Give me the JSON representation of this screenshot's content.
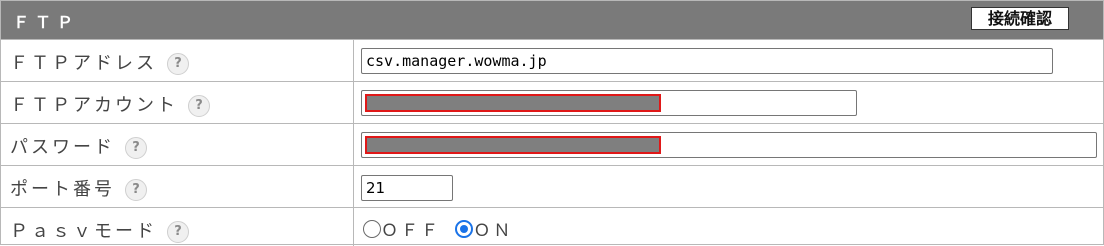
{
  "header": {
    "title": "ＦＴＰ",
    "test_button_label": "接続確認"
  },
  "rows": {
    "address": {
      "label": "ＦＴＰアドレス",
      "value": "csv.manager.wowma.jp"
    },
    "account": {
      "label": "ＦＴＰアカウント",
      "value": ""
    },
    "password": {
      "label": "パスワード",
      "value": ""
    },
    "port": {
      "label": "ポート番号",
      "value": "21"
    },
    "pasv": {
      "label": "Ｐａｓｖモード",
      "options": [
        {
          "label": "ＯＦＦ",
          "selected": false
        },
        {
          "label": "ＯＮ",
          "selected": true
        }
      ]
    }
  },
  "help_icon_glyph": "?",
  "colors": {
    "header_bg": "#7a7a7a",
    "border": "#b8b8b8",
    "redaction_fill": "#7f7f7f",
    "redaction_outline": "#e01818",
    "radio_accent": "#1a73e8"
  }
}
